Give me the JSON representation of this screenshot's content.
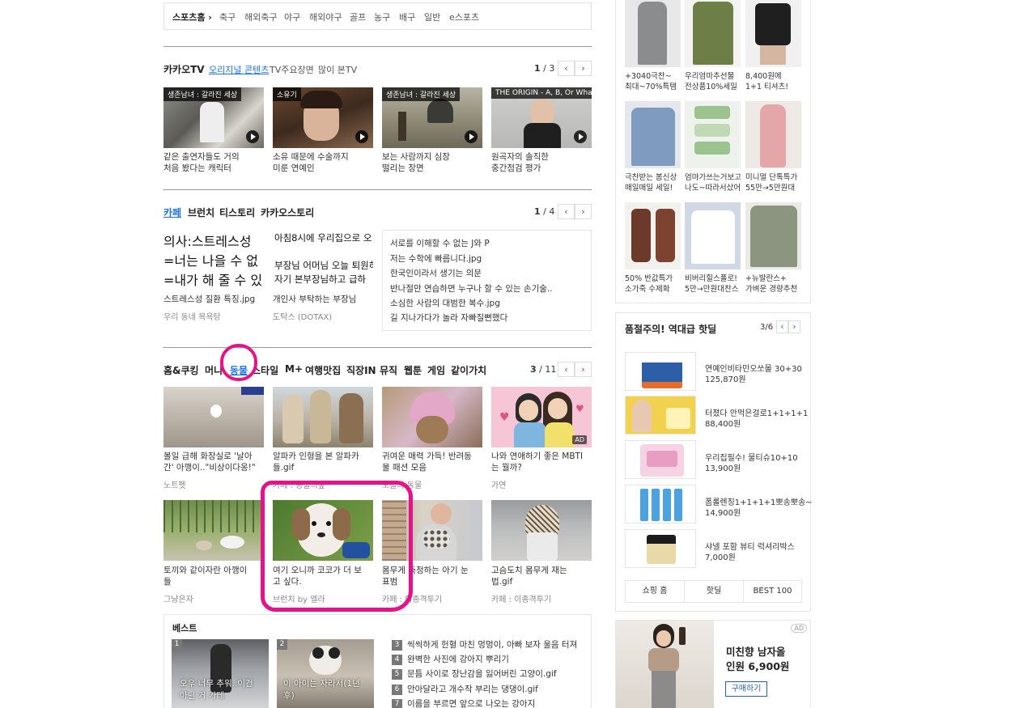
{
  "sports": {
    "lead": "스포츠홈 ›",
    "items": [
      "축구",
      "해외축구",
      "야구",
      "해외야구",
      "골프",
      "농구",
      "배구",
      "일반",
      "e스포츠"
    ]
  },
  "kakaotv": {
    "title": "카카오TV",
    "tabs": [
      "오리지널 콘텐츠",
      "TV주요장면",
      "많이 본TV"
    ],
    "page_current": "1",
    "page_total": " / 3",
    "cards": [
      {
        "badge": "생존남녀 : 갈라진 세상",
        "line1": "같은 출연자들도 거의",
        "line2": "처음 봤다는 캐릭터"
      },
      {
        "badge": "소유기",
        "line1": "소유 때문에 수술까지",
        "line2": "미룬 연예인"
      },
      {
        "badge": "생존남녀 : 갈라진 세상",
        "line1": "보는 사람까지 심장",
        "line2": "떨리는 장면"
      },
      {
        "badge": "THE ORIGIN - A, B, Or What?",
        "line1": "원곡자의 솔직한",
        "line2": "중간점검 평가"
      }
    ]
  },
  "cafe": {
    "tabs": [
      "카페",
      "브런치",
      "티스토리",
      "카카오스토리"
    ],
    "page_current": "1",
    "page_total": " / 4",
    "img_text": [
      "의사:스트레스성",
      "=너는 나을 수 없",
      "=내가 해 줄 수 있"
    ],
    "card1": {
      "title": "스트레스성 질환 특징.jpg",
      "src": "우리 동네 목욕탕"
    },
    "card2": {
      "l1": "아침8시에 우리집으로 오",
      "l2": "부장님 어머님 오늘 퇴원하",
      "l3": "자기 본부장님하고 급하",
      "title": "개인사 부탁하는 부장님",
      "src": "도탁스 (DOTAX)"
    },
    "list": [
      "서로를 이해할 수 없는 J와 P",
      "저는 수학에 빠릅니다.jpg",
      "한국인이라서 생기는 의문",
      "반나절만 연습하면 누구나 할 수 있는 손기술..",
      "소심한 사람의 대범한 복수.jpg",
      "길 지나가다가 놀라 자빠질뻔했다"
    ]
  },
  "theme": {
    "tabs": [
      "홈&쿠킹",
      "머니",
      "동물",
      "스타일",
      "M+",
      "여행맛집",
      "직장IN",
      "뮤직",
      "웹툰",
      "게임",
      "같이가치"
    ],
    "page_current": "3",
    "page_total": " / 11",
    "row1": [
      {
        "l1": "볼일 급해 화장실로 '날아",
        "l2": "간' 아깽이..\"비상이다옹!\"",
        "src": "노트펫"
      },
      {
        "l1": "알파카 인형을 본 알파카",
        "l2": "들.gif",
        "src": "카페 : 동물의숲"
      },
      {
        "l1": "귀여운 매력 가득! 반려동",
        "l2": "물 패션 모음",
        "src": "오늘의 동물"
      },
      {
        "l1": "나와 연애하기 좋은 MBTI",
        "l2": "는 뭘까?",
        "src": "가연",
        "ad": "AD"
      }
    ],
    "row2": [
      {
        "l1": "토끼와 같이자란 아깽이",
        "l2": "들",
        "src": "그냥은자"
      },
      {
        "l1": "여기 오니까 코코가 더 보",
        "l2": "고 싶다.",
        "src": "브런치 by 엘라"
      },
      {
        "l1": "몸무게 측정하는 아기 눈",
        "l2": "표범",
        "src": "카페 : 이종격투기"
      },
      {
        "l1": "고슴도치 몸무게 재는",
        "l2": "법.gif",
        "src": "카페 : 이종격투기"
      }
    ]
  },
  "best": {
    "title": "베스트",
    "cards": [
      {
        "num": "1",
        "l1": "오우 너무 추워..이건",
        "l2": "아닌 거 가테"
      },
      {
        "num": "2",
        "l1": "이 아이는 자라서(1년",
        "l2": "후)"
      }
    ],
    "list": [
      {
        "num": "3",
        "text": "씩씩하게 헌혈 마친 멍멍이, 아빠 보자 울음 터져"
      },
      {
        "num": "4",
        "text": "완벽한 사진에 강아지 뿌리기"
      },
      {
        "num": "5",
        "text": "문틈 사이로 장난감을 잃어버린 고양이.gif"
      },
      {
        "num": "6",
        "text": "안아달라고 개수작 부리는 댕댕이.gif"
      },
      {
        "num": "7",
        "text": "이름을 부르면 앞으로 나오는 강아지"
      }
    ]
  },
  "shop": {
    "items": [
      {
        "l1": "+3040극찬~",
        "l2": "최대~70%특템"
      },
      {
        "l1": "우리엄마추선물",
        "l2": "전상품10%세일"
      },
      {
        "l1": "8,400원에",
        "l2": "1+1 티셔츠!"
      },
      {
        "l1": "극찬받는 봄신상",
        "l2": "매일매일 세일!"
      },
      {
        "l1": "엄마가쓰는거보고",
        "l2": "나도~따라서샀어"
      },
      {
        "l1": "미니멀 단톡특가",
        "l2": "55만→5만원대"
      },
      {
        "l1": "50% 반값특가",
        "l2": "소가죽 수제화"
      },
      {
        "l1": "비버리힐스폴로!",
        "l2": "5만→만원대찬스"
      },
      {
        "l1": "+뉴발란스+",
        "l2": "가벼운 경량추천"
      }
    ]
  },
  "hot": {
    "title": "품절주의! 역대급 핫딜",
    "page": "3/6",
    "items": [
      {
        "name": "연예인비타민오쏘몰 30+30",
        "price": "125,870원"
      },
      {
        "name": "터졌다 안먹은걸로1+1+1+1",
        "price": "88,400원"
      },
      {
        "name": "우리집필수! 물티슈10+10",
        "price": "13,900원"
      },
      {
        "name": "폼롤렌징1+1+1+1뽀송뽀송~",
        "price": "14,900원"
      },
      {
        "name": "샤넬 포함 뷰티 럭셔리박스",
        "price": "7,000원"
      }
    ],
    "tabs": [
      "쇼핑 홈",
      "핫딜",
      "BEST 100"
    ]
  },
  "ad": {
    "badge": "AD",
    "l1": "미친향 남자올",
    "l2": "인원 6,900원",
    "button": "구매하기"
  },
  "colors": {
    "accent": "#1a73e8",
    "annotation": "#e5128a"
  }
}
